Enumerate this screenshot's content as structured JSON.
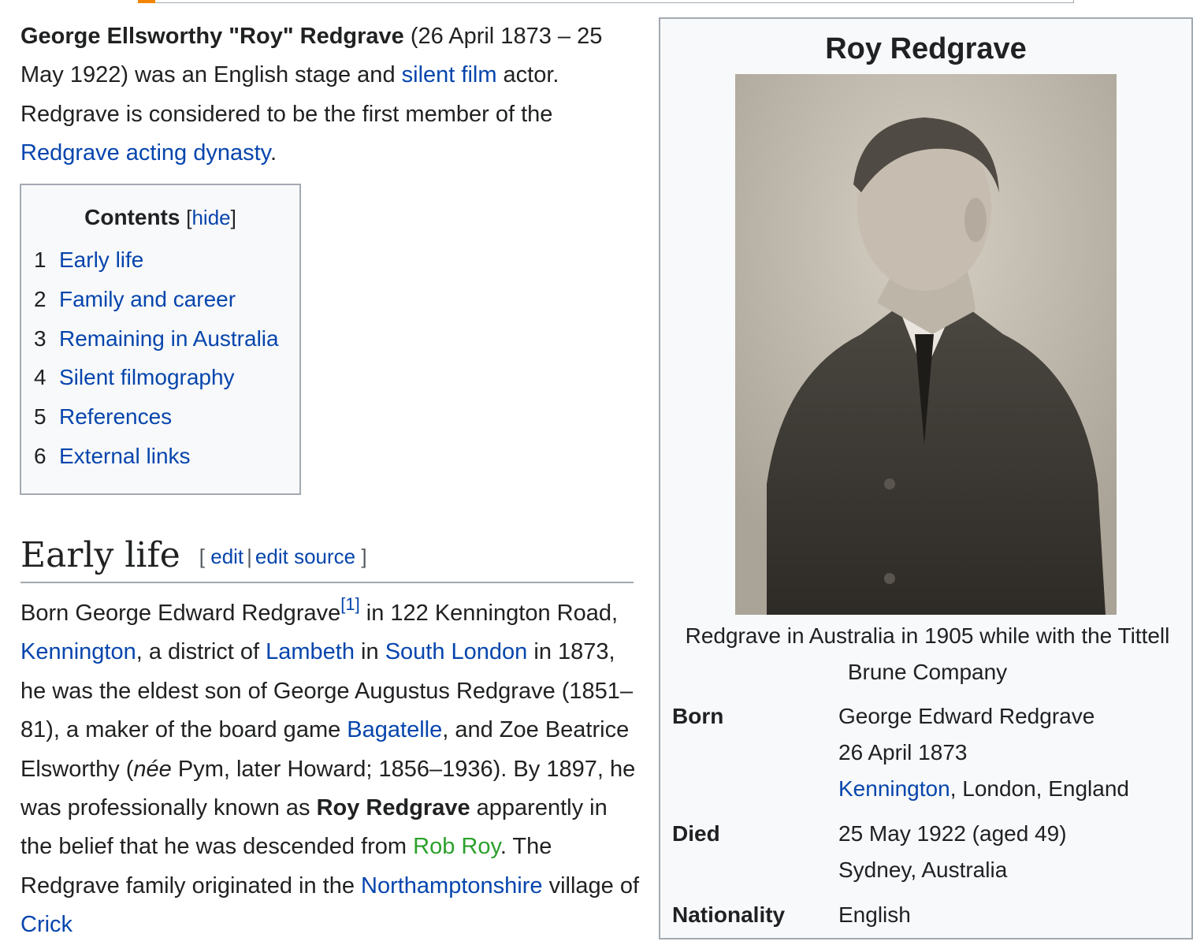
{
  "lead": {
    "name_bold": "George Ellsworthy \"Roy\" Redgrave",
    "text1": " (26 April 1873 – 25 May 1922) was an English stage and ",
    "link_silent_film": "silent film",
    "text2": " actor. Redgrave is considered to be the first member of the ",
    "link_dynasty": "Redgrave acting dynasty",
    "text3": "."
  },
  "toc": {
    "title": "Contents",
    "bracket_open": "[",
    "hide": "hide",
    "bracket_close": "]",
    "items": [
      {
        "num": "1",
        "label": "Early life"
      },
      {
        "num": "2",
        "label": "Family and career"
      },
      {
        "num": "3",
        "label": "Remaining in Australia"
      },
      {
        "num": "4",
        "label": "Silent filmography"
      },
      {
        "num": "5",
        "label": "References"
      },
      {
        "num": "6",
        "label": "External links"
      }
    ]
  },
  "section": {
    "title": "Early life",
    "bracket_open": "[ ",
    "edit": "edit",
    "sep": "|",
    "edit_source": "edit source",
    "bracket_close": " ]"
  },
  "para": {
    "t1": "Born George Edward Redgrave",
    "ref": "[1]",
    "t2": " in 122 Kennington Road, ",
    "l_kennington": "Kennington",
    "t3": ", a district of ",
    "l_lambeth": "Lambeth",
    "t4": " in ",
    "l_south_london": "South London",
    "t5": " in 1873, he was the eldest son of George Augustus Redgrave (1851–81), a maker of the board game ",
    "l_bagatelle": "Bagatelle",
    "t6": ", and Zoe Beatrice Elsworthy (",
    "nee": "née",
    "t7": " Pym, later Howard; 1856–1936). By 1897, he was professionally known as ",
    "bold_name": "Roy Redgrave",
    "t8": " apparently in the belief that he was descended from ",
    "l_rob_roy": "Rob Roy",
    "t9": ". The Redgrave family originated in the ",
    "l_northamptonshire": "Northamptonshire",
    "t10": " village of ",
    "l_crick": "Crick"
  },
  "infobox": {
    "title": "Roy Redgrave",
    "caption": "Redgrave in Australia in 1905 while with the Tittell Brune Company",
    "born_label": "Born",
    "born_name": "George Edward Redgrave",
    "born_date": "26 April 1873",
    "born_place_link": "Kennington",
    "born_place_rest": ", London, England",
    "died_label": "Died",
    "died_date": "25 May 1922 (aged 49)",
    "died_place": "Sydney, Australia",
    "nationality_label": "Nationality",
    "nationality": "English"
  },
  "colors": {
    "link": "#0645ad",
    "visited_green": "#2ca02c",
    "border": "#a2a9b1",
    "accent": "#f28500"
  }
}
